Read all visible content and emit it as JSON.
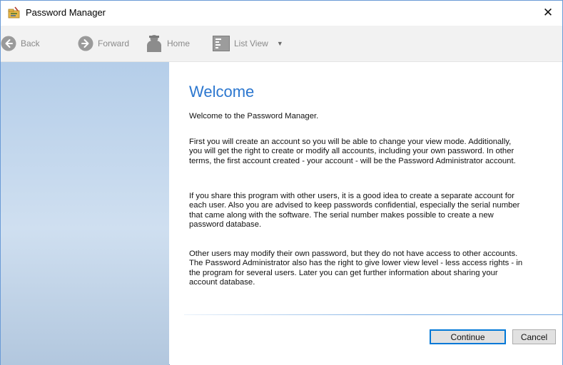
{
  "window": {
    "title": "Password Manager",
    "close_label": "✕"
  },
  "toolbar": {
    "back_label": "Back",
    "forward_label": "Forward",
    "home_label": "Home",
    "view_label": "List View",
    "view_caret": "▼"
  },
  "content": {
    "heading": "Welcome",
    "paragraphs": [
      "Welcome to the Password Manager.",
      "First you will create an account so you will be able to change your view mode. Additionally, you will get the right to create or modify all accounts, including your own password. In other terms, the first account created - your account - will be the Password Administrator account.",
      "If you share this program with other users, it is a good idea to create a separate account for each user. Also you are advised to keep passwords confidential, especially the serial number that came along with the software. The serial number makes possible to create a new password database.",
      "Other users may modify their own password, but they do not have access to other accounts. The Password Administrator also has the right to give lower view level - less access rights - in the program for several users. Later you can get further information about sharing your account database."
    ],
    "continue_label": "Continue",
    "cancel_label": "Cancel"
  },
  "colors": {
    "heading": "#2c77cf",
    "accent": "#0078d7",
    "sidebar_top": "#b5cee9",
    "sidebar_bottom": "#b2c7de"
  },
  "icons": {
    "app": "app-folder-key-icon",
    "back": "back-arrow-icon",
    "forward": "forward-arrow-icon",
    "home": "home-person-icon",
    "view": "list-view-icon"
  }
}
